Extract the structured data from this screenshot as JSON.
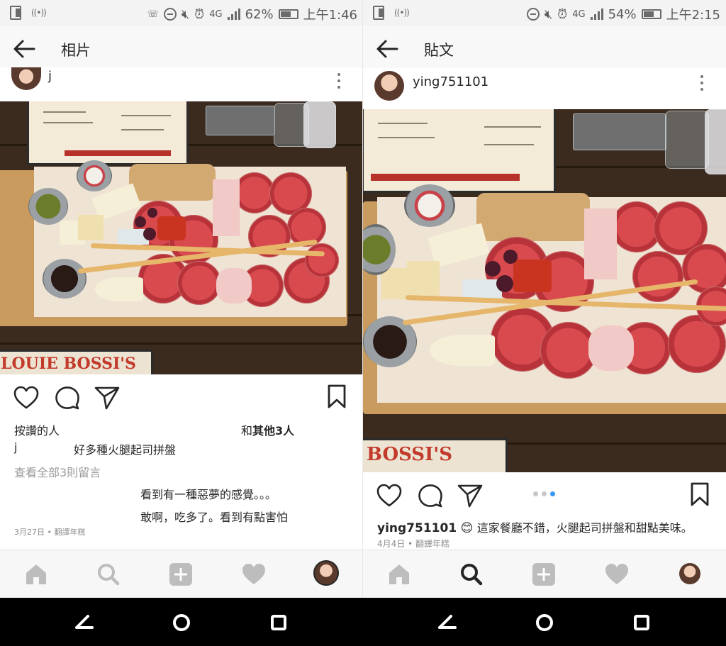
{
  "left": {
    "status": {
      "battery": "62%",
      "time": "上午1:46",
      "network": "4G"
    },
    "app_bar": {
      "title": "相片"
    },
    "post": {
      "username": "j",
      "photo_banner": "LOUIE BOSSI'S"
    },
    "likes": {
      "label": "按讚的人",
      "others_prefix": "和",
      "others_bold": "其他3人"
    },
    "caption": {
      "username": "j",
      "text": "好多種火腿起司拼盤"
    },
    "view_all_comments": "查看全部3則留言",
    "comments": [
      "看到有一種惡夢的感覺。。。",
      "敢啊，吃多了。看到有點害怕"
    ],
    "date": "3月27日 • 翻譯年糕"
  },
  "right": {
    "status": {
      "battery": "54%",
      "time": "上午2:15",
      "network": "4G"
    },
    "app_bar": {
      "title": "貼文"
    },
    "post": {
      "username": "ying751101",
      "photo_banner": "BOSSI'S"
    },
    "carousel": {
      "count": 3,
      "active": 3
    },
    "caption": {
      "username": "ying751101",
      "emoji": "😊",
      "text": "這家餐廳不錯，火腿起司拼盤和甜點美味。"
    },
    "date": "4月4日 • 翻譯年糕"
  },
  "icons": {
    "back": "arrow-left-icon",
    "more": "more-vertical-icon",
    "heart": "heart-icon",
    "comment": "comment-icon",
    "share": "paper-plane-icon",
    "bookmark": "bookmark-icon",
    "home": "home-icon",
    "search": "search-icon",
    "add": "add-post-icon",
    "activity": "heart-activity-icon",
    "profile": "profile-avatar"
  },
  "colors": {
    "text": "#262626",
    "muted": "#8e8e8e",
    "carousel_active": "#3897f0",
    "nav_inactive": "#bdbdbd"
  }
}
